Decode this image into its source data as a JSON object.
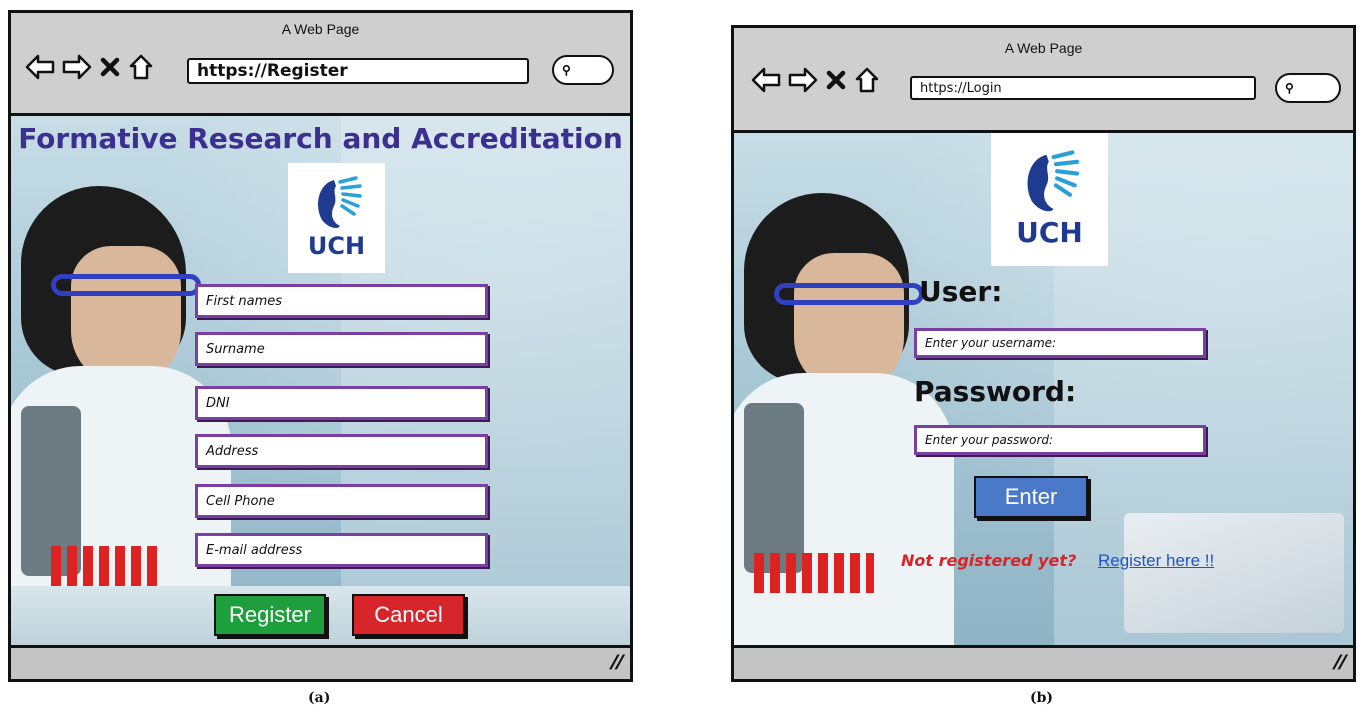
{
  "register": {
    "window_title": "A Web Page",
    "url": "https://Register",
    "heading": "Formative Research and Accreditation",
    "logo_text": "UCH",
    "fields": [
      {
        "placeholder": "First names"
      },
      {
        "placeholder": "Surname"
      },
      {
        "placeholder": "DNI"
      },
      {
        "placeholder": "Address"
      },
      {
        "placeholder": "Cell Phone"
      },
      {
        "placeholder": "E-mail address"
      }
    ],
    "register_label": "Register",
    "cancel_label": "Cancel",
    "caption": "(a)"
  },
  "login": {
    "window_title": "A Web Page",
    "url": "https://Login",
    "logo_text": "UCH",
    "user_label": "User:",
    "username_placeholder": "Enter your username:",
    "password_label": "Password:",
    "password_placeholder": "Enter your password:",
    "enter_label": "Enter",
    "not_registered": "Not registered yet?",
    "register_link": "Register here !!",
    "caption": "(b)"
  },
  "colors": {
    "heading": "#3b2f8f",
    "field_border": "#7a3fa0",
    "register_button": "#1e9e3c",
    "cancel_button": "#d6262b",
    "enter_button": "#4a79c9",
    "not_registered": "#d6262b",
    "link": "#1f56c4",
    "logo": "#1f3b8f"
  },
  "icons": [
    "back-arrow-icon",
    "forward-arrow-icon",
    "close-x-icon",
    "home-icon",
    "search-icon",
    "resize-grip-icon",
    "uch-logo-icon"
  ]
}
